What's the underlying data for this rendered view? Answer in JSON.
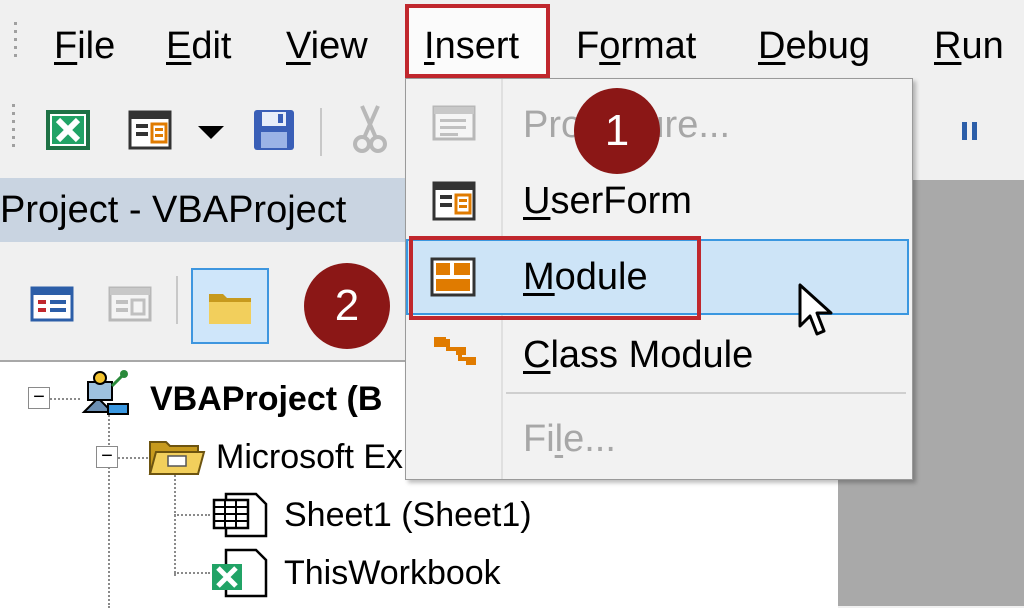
{
  "menubar": {
    "items": [
      {
        "label": "File",
        "accel": "F",
        "rest": "ile"
      },
      {
        "label": "Edit",
        "accel": "E",
        "rest": "dit"
      },
      {
        "label": "View",
        "accel": "V",
        "rest": "iew"
      },
      {
        "label": "Insert",
        "accel": "I",
        "rest": "nsert"
      },
      {
        "label": "Format",
        "pre": "F",
        "accel": "o",
        "rest": "rmat"
      },
      {
        "label": "Debug",
        "accel": "D",
        "rest": "ebug"
      },
      {
        "label": "Run",
        "accel": "R",
        "rest": "un"
      }
    ]
  },
  "toolbar": {
    "icons": [
      "excel-view-icon",
      "insert-userform-icon",
      "dropdown-arrow-icon",
      "save-icon",
      "cut-icon",
      "pause-icon"
    ]
  },
  "project": {
    "title": "Project - VBAProject",
    "toolbar_icons": [
      "view-code-icon",
      "view-object-icon",
      "toggle-folders-icon"
    ]
  },
  "tree": {
    "root": "VBAProject (B",
    "folder": "Microsoft Ex",
    "items": [
      "Sheet1 (Sheet1)",
      "ThisWorkbook"
    ],
    "expander_symbol": "−"
  },
  "dropdown": {
    "items": [
      {
        "pre": "Pro",
        "accel": "",
        "rest": "cedure...",
        "label": "Procedure...",
        "enabled": false,
        "icon": "procedure-icon"
      },
      {
        "pre": "",
        "accel": "U",
        "rest": "serForm",
        "label": "UserForm",
        "enabled": true,
        "icon": "userform-icon"
      },
      {
        "pre": "",
        "accel": "M",
        "rest": "odule",
        "label": "Module",
        "enabled": true,
        "highlighted": true,
        "icon": "module-icon"
      },
      {
        "pre": "",
        "accel": "C",
        "rest": "lass Module",
        "label": "Class Module",
        "enabled": true,
        "icon": "class-module-icon"
      },
      {
        "pre": "Fi",
        "accel": "l",
        "rest": "e...",
        "label": "File...",
        "enabled": false,
        "icon": ""
      }
    ]
  },
  "badges": {
    "step1": "1",
    "step2": "2"
  },
  "colors": {
    "highlight_red": "#c0272d",
    "badge_red": "#8b1716",
    "selection_blue": "#cde4f7",
    "selection_border": "#3a97e0",
    "pane_header": "#c9d4e1"
  }
}
